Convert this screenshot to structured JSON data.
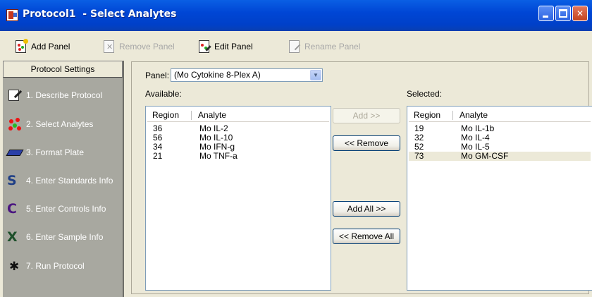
{
  "window": {
    "title": "Protocol1  - Select Analytes"
  },
  "toolbar": {
    "add_panel": "Add Panel",
    "remove_panel": "Remove Panel",
    "edit_panel": "Edit Panel",
    "rename_panel": "Rename Panel"
  },
  "sidebar": {
    "header": "Protocol Settings",
    "items": [
      {
        "label": "1. Describe Protocol",
        "icon": "notepad-pen-icon"
      },
      {
        "label": "2. Select Analytes",
        "icon": "analyte-beads-icon"
      },
      {
        "label": "3. Format Plate",
        "icon": "plate-icon"
      },
      {
        "label": "4. Enter Standards Info",
        "icon": "standards-tube-icon"
      },
      {
        "label": "5. Enter Controls Info",
        "icon": "controls-tube-icon"
      },
      {
        "label": "6. Enter Sample Info",
        "icon": "sample-tube-icon"
      },
      {
        "label": "7. Run Protocol",
        "icon": "runner-icon"
      }
    ]
  },
  "main": {
    "panel_label": "Panel:",
    "panel_value": "(Mo Cytokine 8-Plex A)",
    "available_label": "Available:",
    "selected_label": "Selected:",
    "columns": {
      "region": "Region",
      "analyte": "Analyte"
    },
    "available_rows": [
      {
        "region": "36",
        "analyte": "Mo IL-2"
      },
      {
        "region": "56",
        "analyte": "Mo IL-10"
      },
      {
        "region": "34",
        "analyte": "Mo IFN-g"
      },
      {
        "region": "21",
        "analyte": "Mo TNF-a"
      }
    ],
    "selected_rows": [
      {
        "region": "19",
        "analyte": "Mo IL-1b"
      },
      {
        "region": "32",
        "analyte": "Mo IL-4"
      },
      {
        "region": "52",
        "analyte": "Mo IL-5"
      },
      {
        "region": "73",
        "analyte": "Mo GM-CSF"
      }
    ],
    "buttons": {
      "add": "Add >>",
      "remove": "<< Remove",
      "add_all": "Add All >>",
      "remove_all": "<< Remove All"
    }
  },
  "colors": {
    "titlebar": "#0046D5",
    "sidebar_bg": "#A8A8A0",
    "selected_row": "#ECE9D8"
  }
}
